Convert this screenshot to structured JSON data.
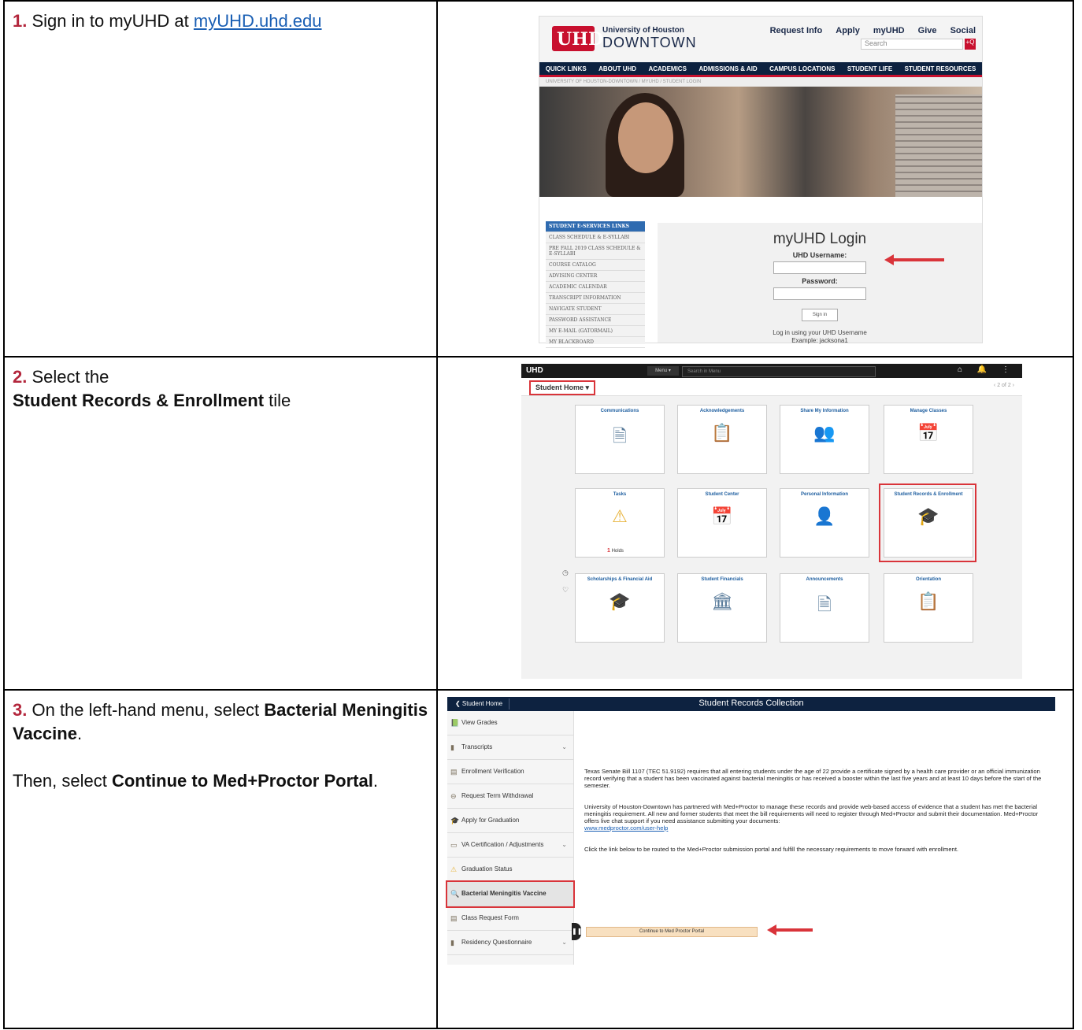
{
  "steps": [
    {
      "number": "1.",
      "text_before": "Sign in to myUHD at ",
      "link": "myUHD.uhd.edu",
      "shot": {
        "uni_small": "University of Houston",
        "uni_big": "DOWNTOWN",
        "logo": "UHD",
        "top_nav": [
          "Request Info",
          "Apply",
          "myUHD",
          "Give",
          "Social"
        ],
        "search_placeholder": "Search",
        "search_btn": "+Q",
        "main_nav": [
          "QUICK LINKS",
          "ABOUT UHD",
          "ACADEMICS",
          "ADMISSIONS & AID",
          "CAMPUS LOCATIONS",
          "STUDENT LIFE",
          "STUDENT RESOURCES"
        ],
        "breadcrumb": "UNIVERSITY OF HOUSTON-DOWNTOWN / MYUHD / STUDENT LOGIN",
        "side_links": [
          "STUDENT E-SERVICES LINKS",
          "CLASS SCHEDULE & E-SYLLABI",
          "PRE FALL 2019 CLASS SCHEDULE & E-SYLLABI",
          "COURSE CATALOG",
          "ADVISING CENTER",
          "ACADEMIC CALENDAR",
          "TRANSCRIPT INFORMATION",
          "NAVIGATE STUDENT",
          "PASSWORD ASSISTANCE",
          "MY E-MAIL (GATORMAIL)",
          "MY BLACKBOARD"
        ],
        "login_title": "myUHD Login",
        "username_label": "UHD Username:",
        "password_label": "Password:",
        "signin": "Sign in",
        "note1": "Log in using your UHD Username",
        "note2": "Example: jacksona1"
      }
    },
    {
      "number": "2.",
      "line1": "Select the",
      "bold": "Student Records & Enrollment",
      "after": " tile",
      "shot": {
        "menu": "Menu ▾",
        "search": "Search in Menu",
        "icons": "⌂ 🔔 ⋮",
        "student_home": "Student Home ▾",
        "page": "‹  2 of 2  ›",
        "tiles": [
          {
            "title": "Communications",
            "icon": "document-check-icon",
            "glyph": "🗎"
          },
          {
            "title": "Acknowledgements",
            "icon": "clipboard-icon",
            "glyph": "📋"
          },
          {
            "title": "Share My Information",
            "icon": "people-hierarchy-icon",
            "glyph": "👥"
          },
          {
            "title": "Manage Classes",
            "icon": "calendar-user-icon",
            "glyph": "📅"
          },
          {
            "title": "Tasks",
            "icon": "warning-icon",
            "glyph": "⚠",
            "count": "1",
            "count_label": "Holds"
          },
          {
            "title": "Student Center",
            "icon": "calendar-user-icon",
            "glyph": "📅"
          },
          {
            "title": "Personal Information",
            "icon": "user-edit-icon",
            "glyph": "👤"
          },
          {
            "title": "Student Records & Enrollment",
            "icon": "graduates-icon",
            "glyph": "🎓"
          },
          {
            "title": "Scholarships & Financial Aid",
            "icon": "graduate-money-icon",
            "glyph": "🎓"
          },
          {
            "title": "Student Financials",
            "icon": "bank-icon",
            "glyph": "🏛"
          },
          {
            "title": "Announcements",
            "icon": "document-info-icon",
            "glyph": "🗎"
          },
          {
            "title": "Orientation",
            "icon": "clipboard-icon",
            "glyph": "📋"
          }
        ],
        "side_icons": [
          "◷",
          "♡"
        ]
      }
    },
    {
      "number": "3.",
      "text1": "On the left-hand menu, select ",
      "bold1": "Bacterial Meningitis Vaccine",
      "text1_end": ".",
      "text2": "Then, select ",
      "bold2": "Continue to Med+Proctor Portal",
      "text2_end": ".",
      "shot": {
        "back": "❮ Student Home",
        "title": "Student Records Collection",
        "nav": [
          {
            "label": "View Grades",
            "icon": "grades-icon",
            "glyph": "📗",
            "chev": ""
          },
          {
            "label": "Transcripts",
            "icon": "transcript-icon",
            "glyph": "▮",
            "chev": "⌄"
          },
          {
            "label": "Enrollment Verification",
            "icon": "verification-icon",
            "glyph": "▤",
            "chev": ""
          },
          {
            "label": "Request Term Withdrawal",
            "icon": "withdrawal-icon",
            "glyph": "⊖",
            "chev": ""
          },
          {
            "label": "Apply for Graduation",
            "icon": "graduation-icon",
            "glyph": "🎓",
            "chev": ""
          },
          {
            "label": "VA Certification / Adjustments",
            "icon": "va-icon",
            "glyph": "▭",
            "chev": "⌄"
          },
          {
            "label": "Graduation Status",
            "icon": "warning-icon",
            "glyph": "⚠",
            "chev": ""
          },
          {
            "label": "Bacterial Meningitis Vaccine",
            "icon": "search-icon",
            "glyph": "🔍",
            "chev": ""
          },
          {
            "label": "Class Request Form",
            "icon": "form-icon",
            "glyph": "▤",
            "chev": ""
          },
          {
            "label": "Residency Questionnaire",
            "icon": "residency-icon",
            "glyph": "▮",
            "chev": "⌄"
          }
        ],
        "para1": "Texas Senate Bill 1107 (TEC 51.9192) requires that all entering students under the age of 22 provide a certificate signed by a health care provider or an official immunization record verifying that a student has been vaccinated against bacterial meningitis or has received a booster within the last five years and at least 10 days before the start of the semester.",
        "para2": "University of Houston-Downtown has partnered with Med+Proctor to manage these records and provide web-based access of evidence that a student has met the bacterial meningitis requirement. All new and former students that meet the bill requirements will need to register through Med+Proctor and submit their documentation. Med+Proctor offers live chat support if you need assistance submitting your documents:",
        "para2_link": "www.medproctor.com/user-help",
        "para3": "Click the link below to be routed to the Med+Proctor submission portal and fulfill the necessary requirements to move forward with enrollment.",
        "continue_btn": "Continue to Med Proctor Portal"
      }
    }
  ],
  "colors": {
    "accent_red": "#d9343a",
    "uhd_red": "#c8102e",
    "navy": "#0d2240",
    "step_number": "#b3263c",
    "link": "#1a5fb4"
  }
}
